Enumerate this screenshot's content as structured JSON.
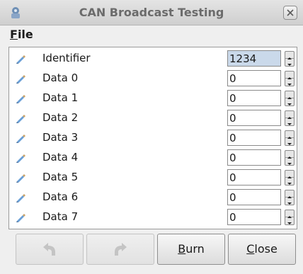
{
  "window": {
    "title": "CAN Broadcast Testing"
  },
  "menu": {
    "file_label": "File",
    "file_mnemonic": "F",
    "file_rest": "ile"
  },
  "fields": [
    {
      "label": "Identifier",
      "value": "1234"
    },
    {
      "label": "Data 0",
      "value": "0"
    },
    {
      "label": "Data 1",
      "value": "0"
    },
    {
      "label": "Data 2",
      "value": "0"
    },
    {
      "label": "Data 3",
      "value": "0"
    },
    {
      "label": "Data 4",
      "value": "0"
    },
    {
      "label": "Data 5",
      "value": "0"
    },
    {
      "label": "Data 6",
      "value": "0"
    },
    {
      "label": "Data 7",
      "value": "0"
    }
  ],
  "buttons": {
    "undo_icon": "undo-icon",
    "redo_icon": "redo-icon",
    "burn_label": "Burn",
    "burn_mnemonic": "B",
    "burn_rest": "urn",
    "close_label": "Close",
    "close_mnemonic": "C",
    "close_rest": "lose"
  },
  "colors": {
    "selection": "#cad9ea",
    "row_icon": "#6a9fd6"
  }
}
